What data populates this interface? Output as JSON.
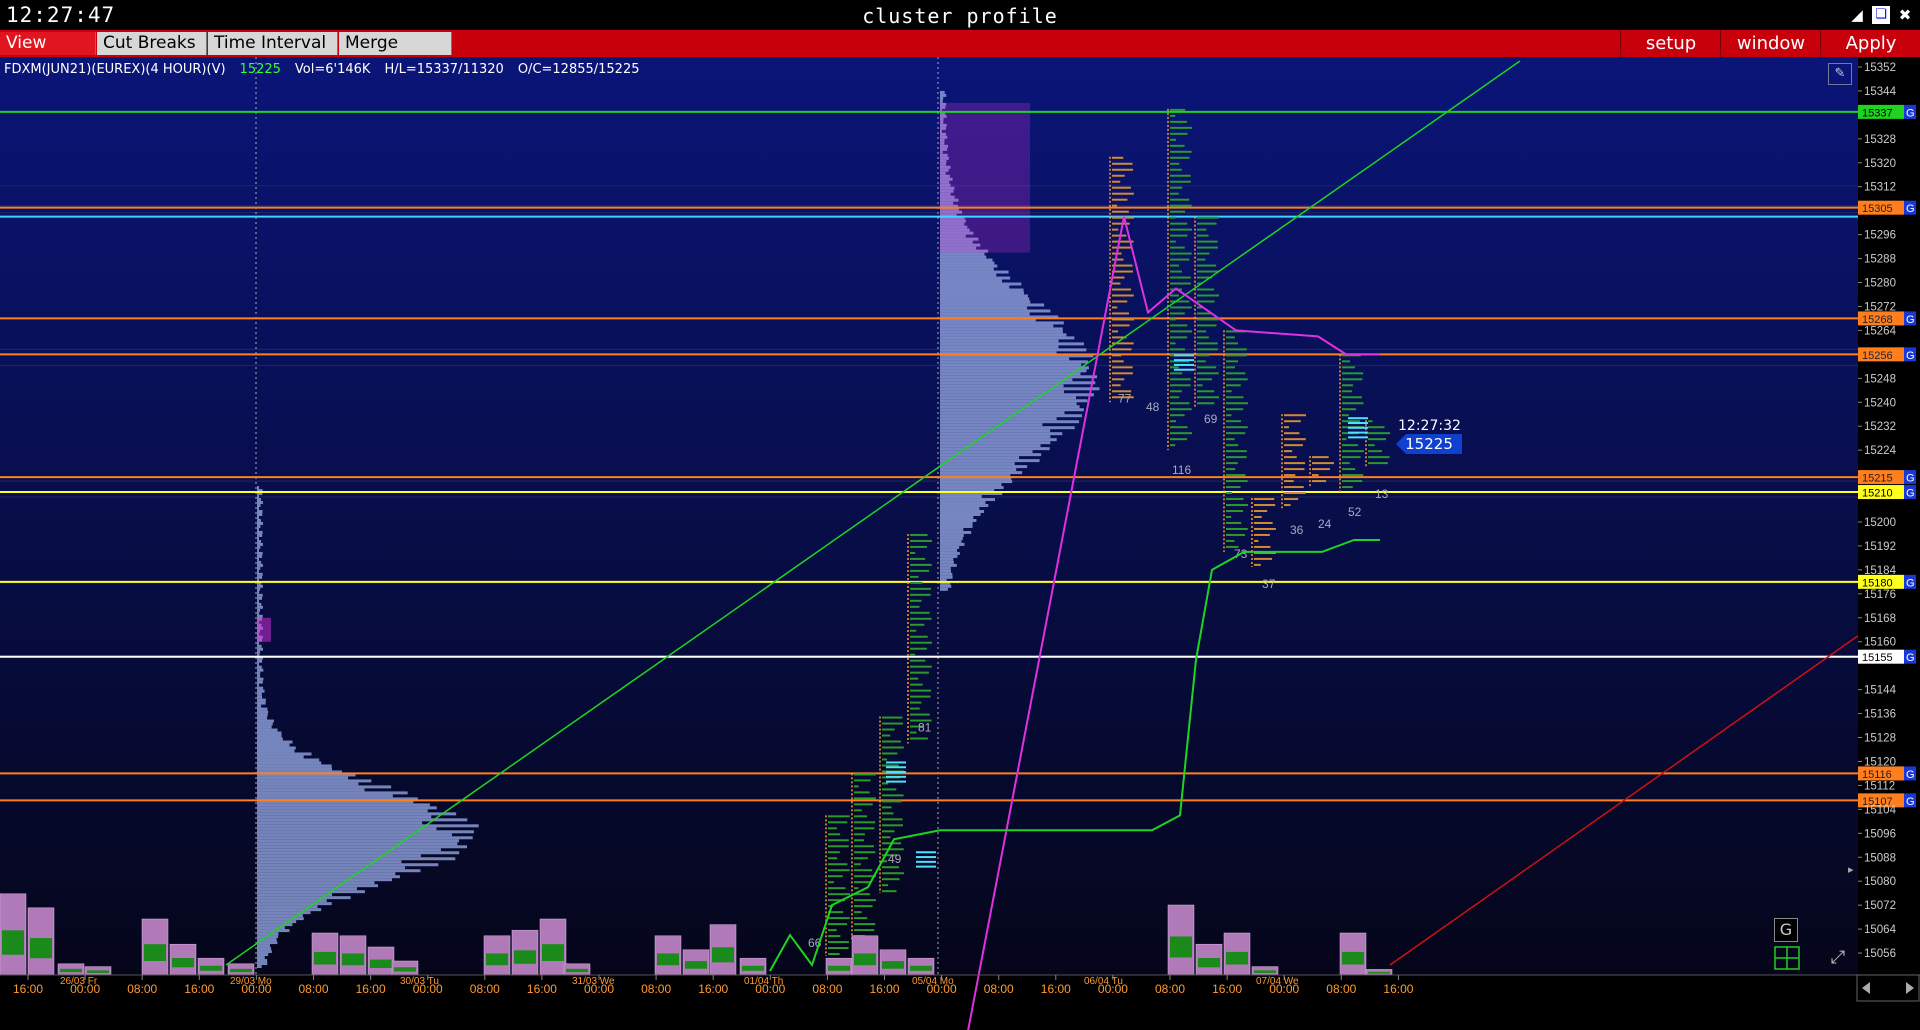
{
  "window": {
    "clock": "12:27:47",
    "title": "cluster profile"
  },
  "toolbar": {
    "left_buttons": [
      "View DOM",
      "Cut Breaks",
      "Time Interval",
      "Merge Contr"
    ],
    "right_buttons": [
      "setup",
      "window",
      "Apply"
    ]
  },
  "instrument": {
    "symbol": "FDXM(JUN21)(EUREX)(4 HOUR)(V)",
    "last": "15225",
    "volume": "Vol=6'146K",
    "high_low": "H/L=15337/11320",
    "open_close": "O/C=12855/15225"
  },
  "current": {
    "time": "12:27:32",
    "price": "15225"
  },
  "colors": {
    "background_top": "#0a1578",
    "background_bottom": "#05061a",
    "toolbar": "#c8000c",
    "green": "#1fd41f",
    "magenta": "#e030e0",
    "red": "#d01010",
    "orange": "#ff7f1f",
    "yellow": "#ffff20",
    "cyan": "#3fd6ff",
    "profile": "#9aa4d8"
  },
  "price_axis": {
    "labels": [
      "15352",
      "15344",
      "15328",
      "15320",
      "15312",
      "15296",
      "15288",
      "15280",
      "15272",
      "15264",
      "15248",
      "15240",
      "15232",
      "15224",
      "15200",
      "15192",
      "15184",
      "15176",
      "15168",
      "15160",
      "15144",
      "15136",
      "15128",
      "15120",
      "15112",
      "15104",
      "15096",
      "15088",
      "15080",
      "15072",
      "15064",
      "15056"
    ],
    "min": 15050,
    "max": 15354
  },
  "levels": [
    {
      "price": 15337,
      "label": "15337",
      "color": "#1fd41f",
      "marker": "G"
    },
    {
      "price": 15305,
      "label": "15305",
      "color": "#ff7f1f",
      "marker": "G"
    },
    {
      "price": 15302,
      "label": "",
      "color": "#3fd6ff",
      "marker": ""
    },
    {
      "price": 15268,
      "label": "15268",
      "color": "#ff7f1f",
      "marker": "G"
    },
    {
      "price": 15256,
      "label": "15256",
      "color": "#ff7f1f",
      "marker": "G"
    },
    {
      "price": 15215,
      "label": "15215",
      "color": "#ff7f1f",
      "marker": "G"
    },
    {
      "price": 15210,
      "label": "15210",
      "color": "#ffff20",
      "marker": "G"
    },
    {
      "price": 15180,
      "label": "15180",
      "color": "#ffff20",
      "marker": "G"
    },
    {
      "price": 15155,
      "label": "15155",
      "color": "#ffffff",
      "marker": "G"
    },
    {
      "price": 15116,
      "label": "15116",
      "color": "#ff7f1f",
      "marker": "G"
    },
    {
      "price": 15107,
      "label": "15107",
      "color": "#ff7f1f",
      "marker": "G"
    }
  ],
  "time_axis": {
    "labels": [
      "16:00",
      "00:00",
      "08:00",
      "16:00",
      "00:00",
      "08:00",
      "16:00",
      "00:00",
      "08:00",
      "16:00",
      "00:00",
      "08:00",
      "16:00",
      "00:00",
      "08:00",
      "16:00",
      "00:00",
      "08:00",
      "16:00",
      "00:00",
      "08:00",
      "16:00",
      "00:00",
      "08:00",
      "16:00"
    ],
    "dates": [
      "26/03 Fr",
      "29/03 Mo",
      "30/03 Tu",
      "31/03 We",
      "01/04 Th",
      "05/04 Mo",
      "06/04 Tu",
      "07/04 We"
    ]
  },
  "bar_counts": [
    "81",
    "49",
    "66",
    "77",
    "48",
    "116",
    "69",
    "73",
    "37",
    "36",
    "24",
    "52",
    "13"
  ],
  "marker_letter": "G"
}
